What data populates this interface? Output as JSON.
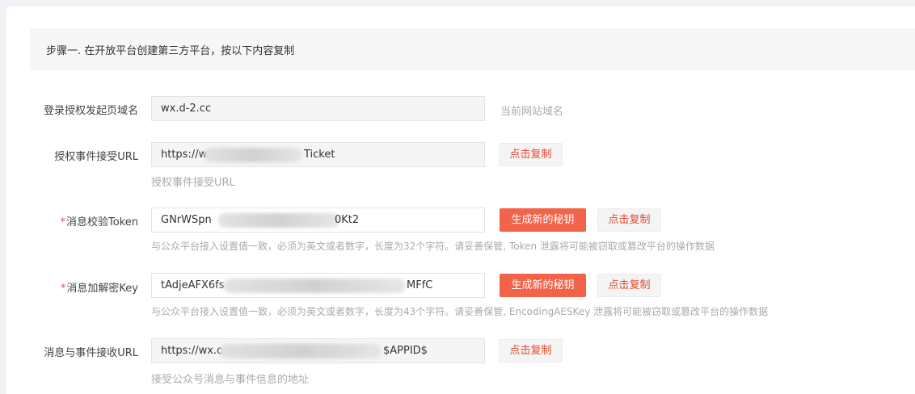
{
  "step": {
    "text": "步骤一. 在开放平台创建第三方平台，按以下内容复制"
  },
  "fields": {
    "domain": {
      "label": "登录授权发起页域名",
      "value": "wx.d-2.cc",
      "side_hint": "当前网站域名"
    },
    "auth_url": {
      "label": "授权事件接受URL",
      "value_prefix": "https://w",
      "value_suffix": "Ticket",
      "hint": "授权事件接受URL",
      "copy_label": "点击复制"
    },
    "token": {
      "required_mark": "*",
      "label": "消息校验Token",
      "value_prefix": "GNrWSpn",
      "value_suffix": "0Kt2",
      "generate_label": "生成新的秘钥",
      "copy_label": "点击复制",
      "hint": "与公众平台接入设置值一致，必须为英文或者数字，长度为32个字符。请妥善保管, Token 泄露将可能被窃取或篡改平台的操作数据"
    },
    "aes_key": {
      "required_mark": "*",
      "label": "消息加解密Key",
      "value_prefix": "tAdjeAFX6fs",
      "value_suffix": "MFfC",
      "generate_label": "生成新的秘钥",
      "copy_label": "点击复制",
      "hint": "与公众平台接入设置值一致，必须为英文或者数字，长度为43个字符。请妥善保管, EncodingAESKey 泄露将可能被窃取或篡改平台的操作数据"
    },
    "msg_url": {
      "label": "消息与事件接收URL",
      "value_prefix": "https://wx.c",
      "value_suffix": "$APPID$",
      "copy_label": "点击复制",
      "hint": "接受公众号消息与事件信息的地址"
    }
  }
}
